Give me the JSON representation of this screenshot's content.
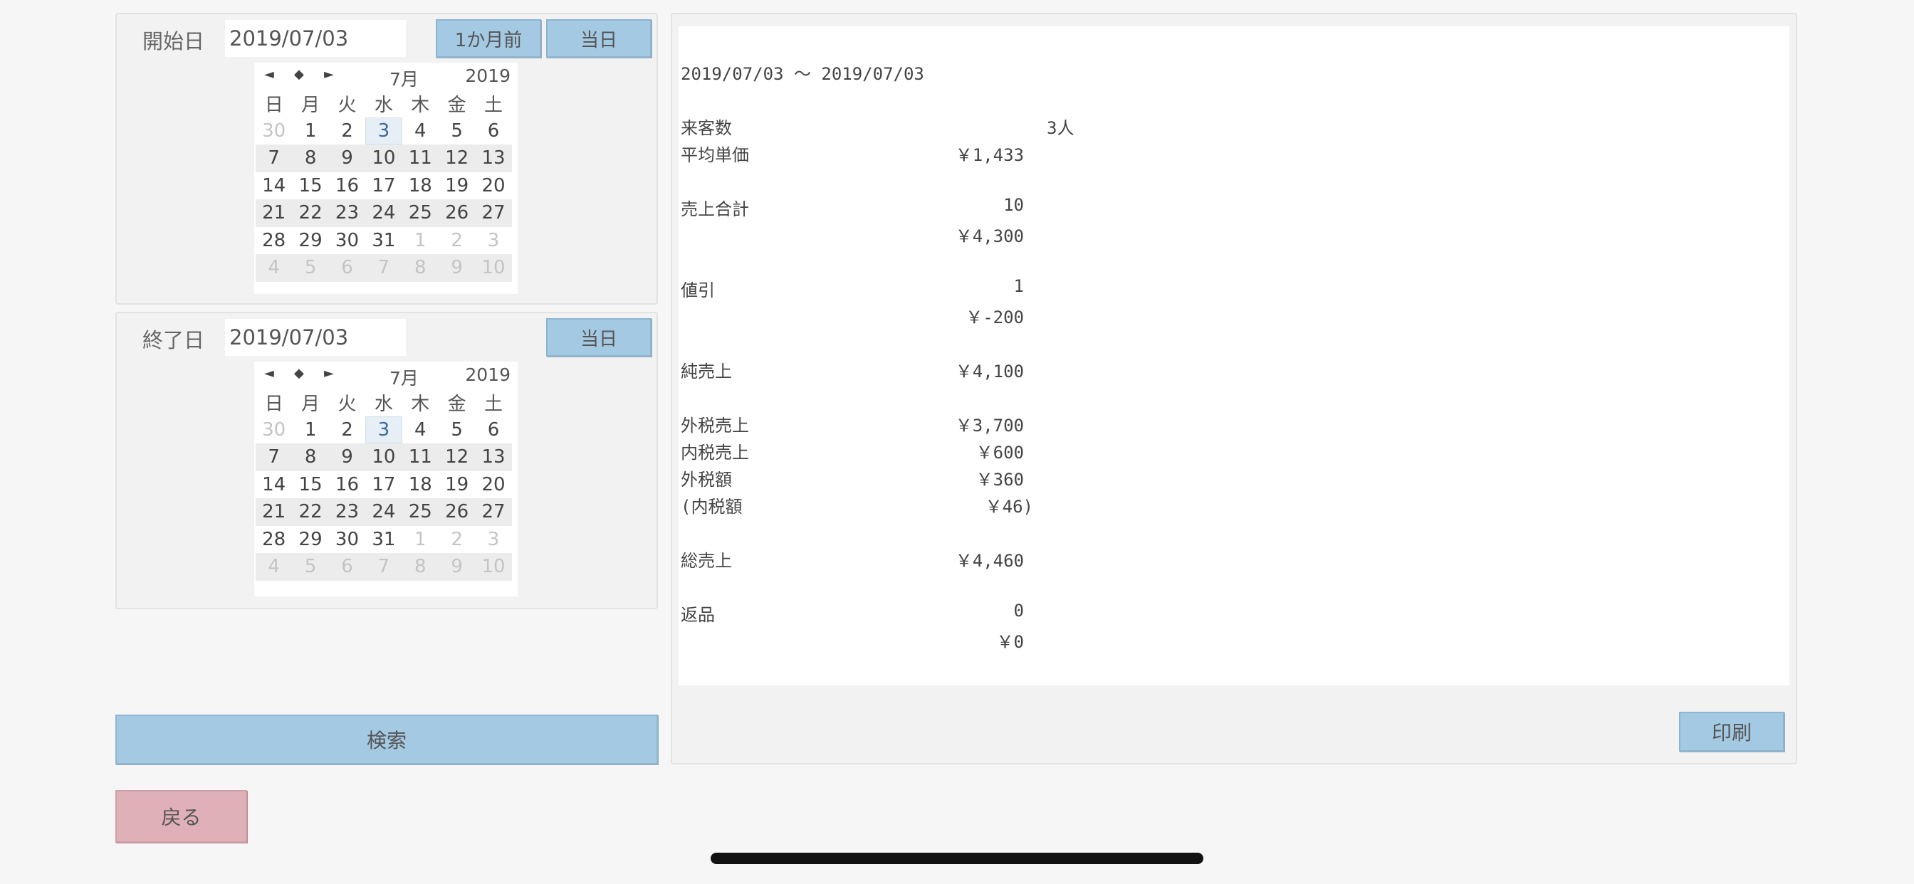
{
  "start": {
    "label": "開始日",
    "date_value": "2019/07/03",
    "month_before_label": "1か月前",
    "today_label": "当日",
    "calendar": {
      "prev_symbol": "◄",
      "current_symbol": "◆",
      "next_symbol": "►",
      "month": "7月",
      "year": "2019",
      "weekdays": [
        "日",
        "月",
        "火",
        "水",
        "木",
        "金",
        "土"
      ],
      "weeks": [
        [
          "30",
          "1",
          "2",
          "3",
          "4",
          "5",
          "6"
        ],
        [
          "7",
          "8",
          "9",
          "10",
          "11",
          "12",
          "13"
        ],
        [
          "14",
          "15",
          "16",
          "17",
          "18",
          "19",
          "20"
        ],
        [
          "21",
          "22",
          "23",
          "24",
          "25",
          "26",
          "27"
        ],
        [
          "28",
          "29",
          "30",
          "31",
          "1",
          "2",
          "3"
        ],
        [
          "4",
          "5",
          "6",
          "7",
          "8",
          "9",
          "10"
        ]
      ],
      "selected": "3"
    }
  },
  "end": {
    "label": "終了日",
    "date_value": "2019/07/03",
    "today_label": "当日",
    "calendar": {
      "prev_symbol": "◄",
      "current_symbol": "◆",
      "next_symbol": "►",
      "month": "7月",
      "year": "2019",
      "weekdays": [
        "日",
        "月",
        "火",
        "水",
        "木",
        "金",
        "土"
      ],
      "weeks": [
        [
          "30",
          "1",
          "2",
          "3",
          "4",
          "5",
          "6"
        ],
        [
          "7",
          "8",
          "9",
          "10",
          "11",
          "12",
          "13"
        ],
        [
          "14",
          "15",
          "16",
          "17",
          "18",
          "19",
          "20"
        ],
        [
          "21",
          "22",
          "23",
          "24",
          "25",
          "26",
          "27"
        ],
        [
          "28",
          "29",
          "30",
          "31",
          "1",
          "2",
          "3"
        ],
        [
          "4",
          "5",
          "6",
          "7",
          "8",
          "9",
          "10"
        ]
      ],
      "selected": "3"
    }
  },
  "search_label": "検索",
  "back_label": "戻る",
  "print_label": "印刷",
  "report": {
    "period": "2019/07/03 〜 2019/07/03",
    "visitors_label": "来客数",
    "visitors_value": "3人",
    "avg_price_label": "平均単価",
    "avg_price_value": "￥1,433",
    "sales_total_label": "売上合計",
    "sales_total_count": "10",
    "sales_total_value": "￥4,300",
    "discount_label": "値引",
    "discount_count": "1",
    "discount_value": "￥-200",
    "net_sales_label": "純売上",
    "net_sales_value": "￥4,100",
    "ext_tax_sales_label": "外税売上",
    "ext_tax_sales_value": "￥3,700",
    "inc_tax_sales_label": "内税売上",
    "inc_tax_sales_value": "￥600",
    "ext_tax_amount_label": "外税額",
    "ext_tax_amount_value": "￥360",
    "inc_tax_amount_label": "(内税額",
    "inc_tax_amount_value": "￥46)",
    "gross_sales_label": "総売上",
    "gross_sales_value": "￥4,460",
    "returns_label": "返品",
    "returns_count": "0",
    "returns_value": "￥0"
  },
  "colors": {
    "button_blue": "#a4c9e3",
    "button_pink": "#e0b0b8",
    "selected_day": "#e6eef6"
  }
}
